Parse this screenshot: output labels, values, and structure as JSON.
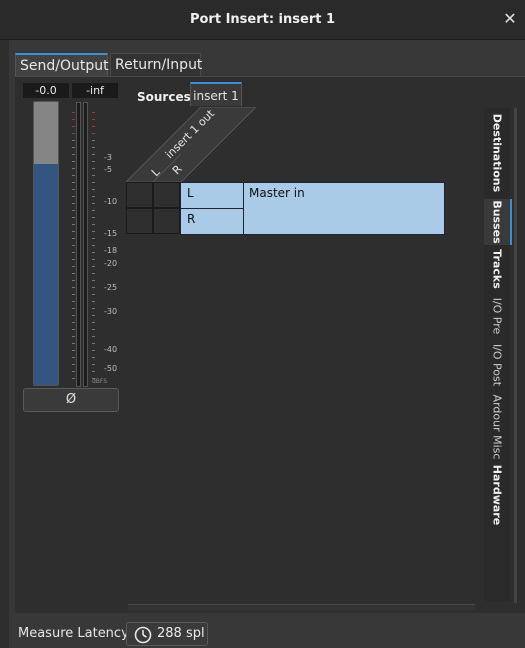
{
  "window": {
    "title": "Port Insert: insert 1",
    "close_glyph": "✕"
  },
  "tabs": [
    {
      "label": "Send/Output"
    },
    {
      "label": "Return/Input"
    }
  ],
  "meter": {
    "gain_value": "-0.0",
    "peak_value": "-inf",
    "fader_level": 0.78,
    "ticks": [
      "-3",
      "-5",
      "-10",
      "-15",
      "-18",
      "-20",
      "-25",
      "-30",
      "-40",
      "-50",
      "dBFS"
    ],
    "invert_label": "Ø"
  },
  "matrix": {
    "sources_label": "Sources",
    "source_tab": "insert 1",
    "column_group": "insert 1 out",
    "columns": [
      "L",
      "R"
    ],
    "rows": [
      "L",
      "R"
    ],
    "destination": "Master in"
  },
  "side_tabs": [
    {
      "label": "Destinations",
      "bold": true
    },
    {
      "label": "Busses",
      "bold": true,
      "active": true
    },
    {
      "label": "Tracks",
      "bold": true
    },
    {
      "label": "I/O Pre",
      "bold": false
    },
    {
      "label": "I/O Post",
      "bold": false
    },
    {
      "label": "Ardour Misc",
      "bold": false
    },
    {
      "label": "Hardware",
      "bold": true
    }
  ],
  "footer": {
    "measure_latency": "Measure Latency",
    "latency_value": "288 spl"
  },
  "colors": {
    "accent": "#3d8fd1",
    "cell_highlight": "#a9cbe8",
    "fader": "#34557f"
  }
}
